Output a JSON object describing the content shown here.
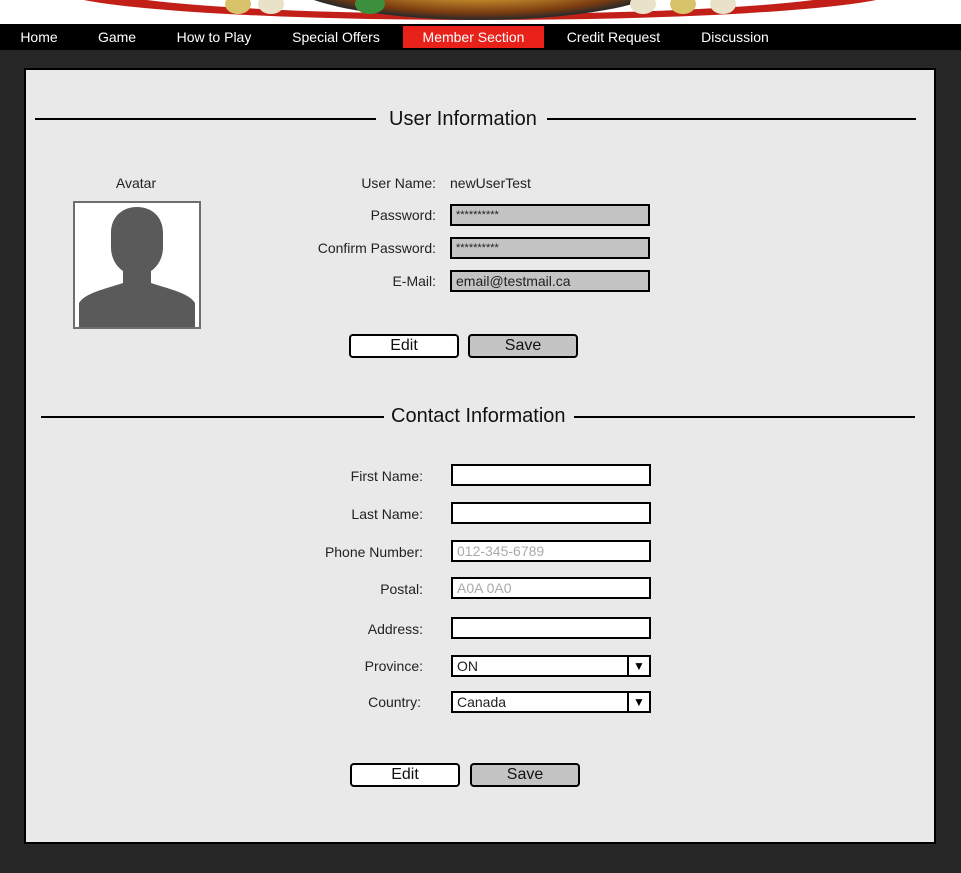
{
  "nav": {
    "items": [
      {
        "label": "Home"
      },
      {
        "label": "Game"
      },
      {
        "label": "How to Play"
      },
      {
        "label": "Special Offers"
      },
      {
        "label": "Member Section"
      },
      {
        "label": "Credit Request"
      },
      {
        "label": "Discussion"
      }
    ],
    "active_index": 4
  },
  "user_info": {
    "title": "User Information",
    "avatar_label": "Avatar",
    "user_name_label": "User Name:",
    "user_name_value": "newUserTest",
    "password_label": "Password:",
    "password_value": "**********",
    "confirm_password_label": "Confirm Password:",
    "confirm_password_value": "**********",
    "email_label": "E-Mail:",
    "email_value": "email@testmail.ca",
    "edit_label": "Edit",
    "save_label": "Save"
  },
  "contact_info": {
    "title": "Contact Information",
    "first_name_label": "First Name:",
    "first_name_value": "",
    "last_name_label": "Last Name:",
    "last_name_value": "",
    "phone_label": "Phone Number:",
    "phone_placeholder": "012-345-6789",
    "postal_label": "Postal:",
    "postal_placeholder": "A0A 0A0",
    "address_label": "Address:",
    "address_value": "",
    "province_label": "Province:",
    "province_value": "ON",
    "country_label": "Country:",
    "country_value": "Canada",
    "edit_label": "Edit",
    "save_label": "Save"
  },
  "colors": {
    "nav_active": "#e8211a",
    "nav_bg": "#000000",
    "frame_bg": "#262626",
    "panel_bg": "#e9e9e9",
    "field_gray": "#c4c4c4"
  },
  "icons": {
    "avatar": "user-silhouette-icon",
    "select_arrow": "triangle-down-icon"
  }
}
